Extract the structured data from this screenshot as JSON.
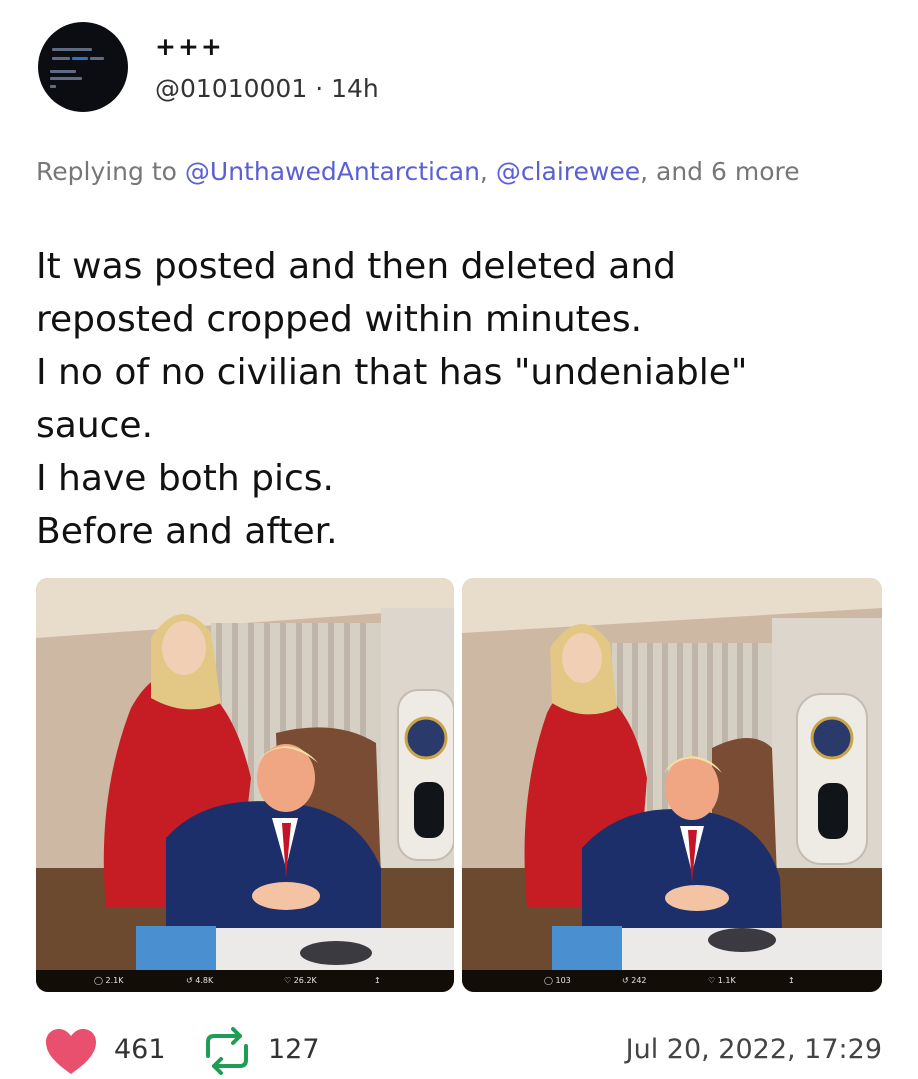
{
  "tweet": {
    "display_name": "+++",
    "handle": "@01010001",
    "separator": "·",
    "age": "14h",
    "reply": {
      "prefix": "Replying to",
      "mention1": "@UnthawedAntarctican",
      "comma": ",",
      "mention2": "@clairewee",
      "suffix": ", and 6 more"
    },
    "body_lines": [
      "It was posted and then deleted and",
      "reposted cropped within minutes.",
      "I no of no civilian that has \"undeniable\"",
      "sauce.",
      "I have both pics.",
      "Before and after."
    ],
    "photos": [
      {
        "subject": "Two people posing at a desk in an aircraft office",
        "stats": {
          "replies": "2.1K",
          "retweets": "4.8K",
          "likes": "26.2K"
        }
      },
      {
        "subject": "Cropped version of the same photo",
        "stats": {
          "replies": "103",
          "retweets": "242",
          "likes": "1.1K"
        }
      }
    ],
    "likes_count": "461",
    "retweets_count": "127",
    "timestamp": "Jul 20, 2022, 17:29"
  },
  "icons": {
    "like": "heart-icon",
    "retweet": "retweet-icon",
    "reply": "comment-icon",
    "share": "share-icon"
  },
  "colors": {
    "mention": "#5b5fd6",
    "heart": "#e8506d",
    "retweet": "#1f9d55",
    "muted_text": "#777777"
  }
}
